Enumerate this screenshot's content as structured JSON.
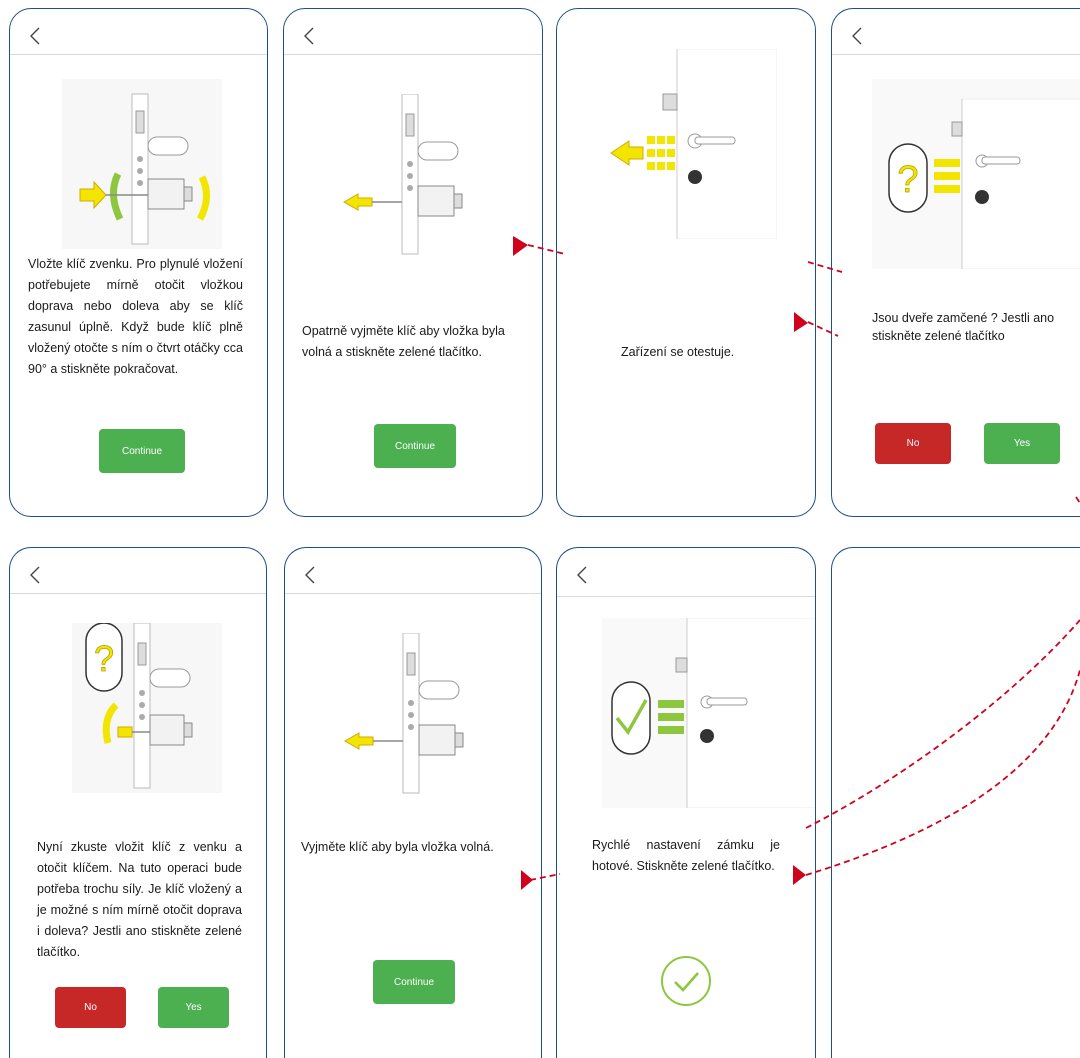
{
  "colors": {
    "frame": "#1f4f8a",
    "green_button": "#4caf50",
    "red_button": "#c62828",
    "arrow": "#d0021b",
    "illustration_yellow": "#f2e600",
    "illustration_green": "#8dc63f"
  },
  "screens": [
    {
      "back_icon": "chevron-left-icon",
      "text": "Vložte klíč zvenku. Pro plynulé vložení potřebujete mírně otočit vložkou doprava nebo doleva aby se klíč zasunul úplně. Když bude klíč plně vložený otočte s ním o čtvrt otáčky cca 90° a stiskněte pokračovat.",
      "continue_label": "Continue"
    },
    {
      "back_icon": "chevron-left-icon",
      "text": "Opatrně vyjměte klíč aby vložka byla volná a stiskněte zelené tlačítko.",
      "continue_label": "Continue"
    },
    {
      "text": "Zařízení se otestuje."
    },
    {
      "back_icon": "chevron-left-icon",
      "text": "Jsou dveře zamčené ? Jestli ano stiskněte zelené tlačítko",
      "no_label": "No",
      "yes_label": "Yes"
    },
    {
      "back_icon": "chevron-left-icon",
      "text": "Nyní zkuste vložit klíč z venku a otočit klíčem. Na tuto operaci bude potřeba trochu síly. Je klíč vložený a je možné s ním mírně otočit doprava i doleva? Jestli ano stiskněte zelené tlačítko.",
      "no_label": "No",
      "yes_label": "Yes"
    },
    {
      "back_icon": "chevron-left-icon",
      "text": "Vyjměte klíč aby byla vložka volná.",
      "continue_label": "Continue"
    },
    {
      "back_icon": "chevron-left-icon",
      "text": "Rychlé nastavení zámku je hotové. Stiskněte zelené tlačítko.",
      "done_icon": "check-circle-icon"
    },
    {}
  ]
}
